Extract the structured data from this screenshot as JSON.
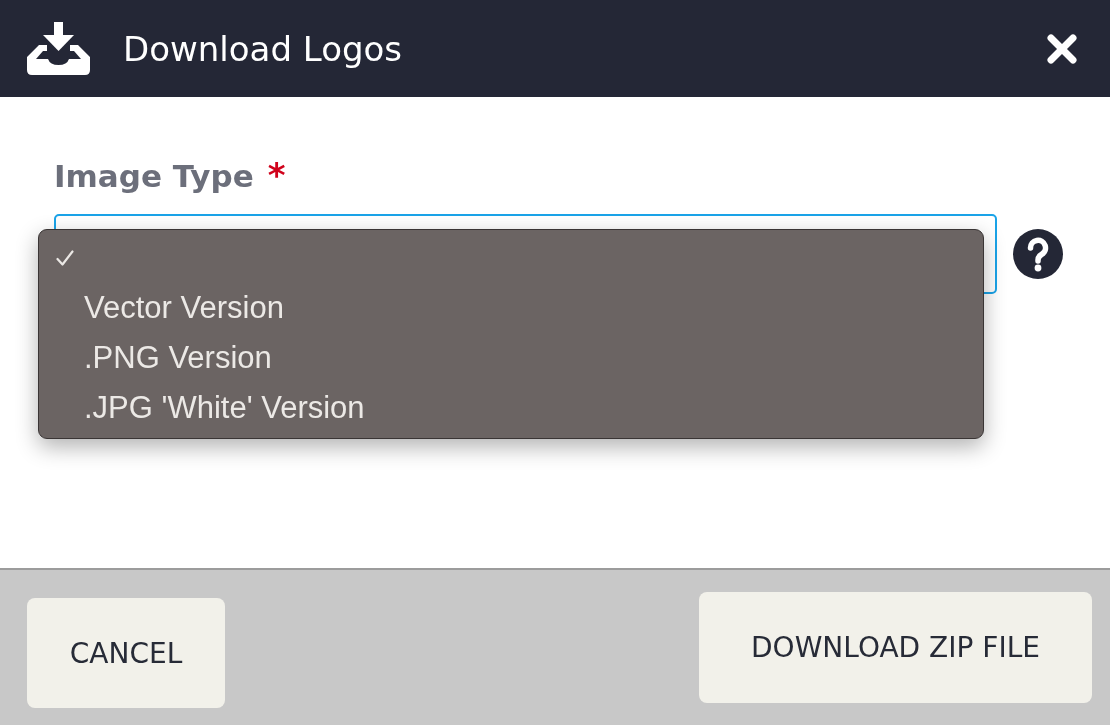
{
  "window": {
    "title": "Download Logos"
  },
  "form": {
    "label": "Image Type",
    "required_mark": "*",
    "field": {
      "expanded": true,
      "options": [
        {
          "selected": true
        },
        {
          "label": "Vector Version",
          "selected": false
        },
        {
          "label": ".PNG Version",
          "selected": false
        },
        {
          "label": ".JPG 'White' Version",
          "selected": false
        }
      ]
    }
  },
  "buttons": [
    {
      "label": "CANCEL"
    },
    {
      "label": "DOWNLOAD ZIP FILE"
    }
  ]
}
